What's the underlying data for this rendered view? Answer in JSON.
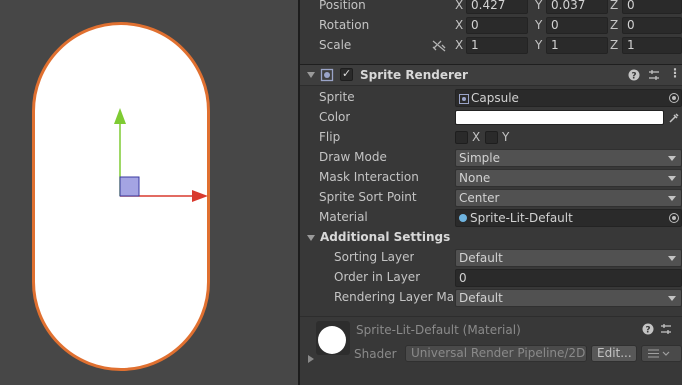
{
  "transform": {
    "position": {
      "label": "Position",
      "x_axis": "X",
      "x": "0.427",
      "y_axis": "Y",
      "y": "0.037",
      "z_axis": "Z",
      "z": "0"
    },
    "rotation": {
      "label": "Rotation",
      "x_axis": "X",
      "x": "0",
      "y_axis": "Y",
      "y": "0",
      "z_axis": "Z",
      "z": "0"
    },
    "scale": {
      "label": "Scale",
      "x_axis": "X",
      "x": "1",
      "y_axis": "Y",
      "y": "1",
      "z_axis": "Z",
      "z": "1"
    }
  },
  "sprite_renderer": {
    "title": "Sprite Renderer",
    "enabled": true,
    "sprite": {
      "label": "Sprite",
      "value": "Capsule"
    },
    "color": {
      "label": "Color",
      "value": "#ffffff"
    },
    "flip": {
      "label": "Flip",
      "x_label": "X",
      "y_label": "Y"
    },
    "draw_mode": {
      "label": "Draw Mode",
      "value": "Simple"
    },
    "mask_interaction": {
      "label": "Mask Interaction",
      "value": "None"
    },
    "sprite_sort_point": {
      "label": "Sprite Sort Point",
      "value": "Center"
    },
    "material": {
      "label": "Material",
      "value": "Sprite-Lit-Default"
    },
    "additional_settings": {
      "label": "Additional Settings",
      "sorting_layer": {
        "label": "Sorting Layer",
        "value": "Default"
      },
      "order_in_layer": {
        "label": "Order in Layer",
        "value": "0"
      },
      "rendering_layer_mask": {
        "label": "Rendering Layer Mas",
        "value": "Default"
      }
    }
  },
  "material_preview": {
    "title": "Sprite-Lit-Default (Material)",
    "shader_label": "Shader",
    "shader_value": "Universal Render Pipeline/2D",
    "edit_label": "Edit..."
  },
  "icons": [
    "help-icon",
    "preset-icon",
    "more-icon",
    "constrain-proportions-icon",
    "eyedropper-icon",
    "object-picker-icon"
  ],
  "colors": {
    "capsule_outline": "#e07030",
    "x_axis": "#d93a2e",
    "y_axis": "#7ecb33",
    "center_handle": "#8f8fd8"
  }
}
